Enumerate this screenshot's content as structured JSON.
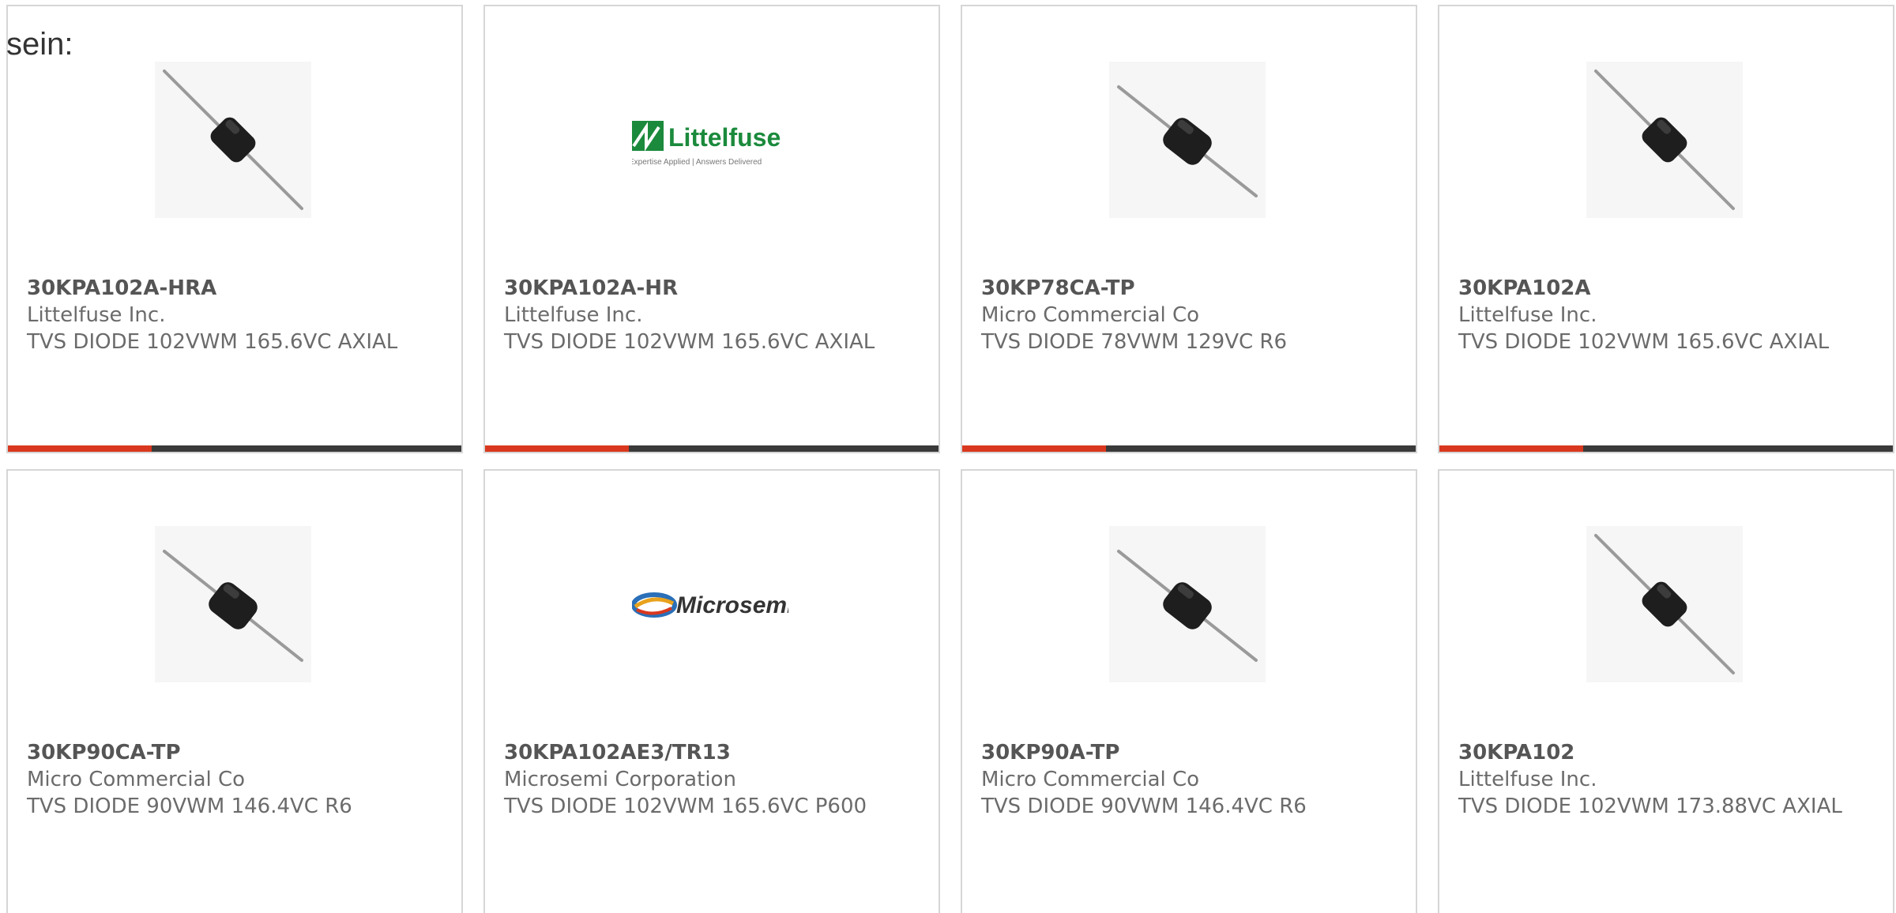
{
  "intro_text": "sein:",
  "colors": {
    "accent_bar": "#d9381e",
    "dark_bar": "#3a3a3a",
    "littelfuse_green": "#1b8a3c"
  },
  "products": [
    {
      "part": "30KPA102A-HRA",
      "maker": "Littelfuse Inc.",
      "desc": "TVS DIODE 102VWM 165.6VC AXIAL",
      "image": "axial-diode-icon"
    },
    {
      "part": "30KPA102A-HR",
      "maker": "Littelfuse Inc.",
      "desc": "TVS DIODE 102VWM 165.6VC AXIAL",
      "image": "littelfuse-logo",
      "logo_text": "Littelfuse",
      "logo_tagline": "Expertise Applied | Answers Delivered"
    },
    {
      "part": "30KP78CA-TP",
      "maker": "Micro Commercial Co",
      "desc": "TVS DIODE 78VWM 129VC R6",
      "image": "axial-diode-icon"
    },
    {
      "part": "30KPA102A",
      "maker": "Littelfuse Inc.",
      "desc": "TVS DIODE 102VWM 165.6VC AXIAL",
      "image": "axial-diode-icon"
    },
    {
      "part": "30KP90CA-TP",
      "maker": "Micro Commercial Co",
      "desc": "TVS DIODE 90VWM 146.4VC R6",
      "image": "axial-diode-icon"
    },
    {
      "part": "30KPA102AE3/TR13",
      "maker": "Microsemi Corporation",
      "desc": "TVS DIODE 102VWM 165.6VC P600",
      "image": "microsemi-logo",
      "logo_text": "Microsemi"
    },
    {
      "part": "30KP90A-TP",
      "maker": "Micro Commercial Co",
      "desc": "TVS DIODE 90VWM 146.4VC R6",
      "image": "axial-diode-icon"
    },
    {
      "part": "30KPA102",
      "maker": "Littelfuse Inc.",
      "desc": "TVS DIODE 102VWM 173.88VC AXIAL",
      "image": "axial-diode-icon"
    }
  ]
}
